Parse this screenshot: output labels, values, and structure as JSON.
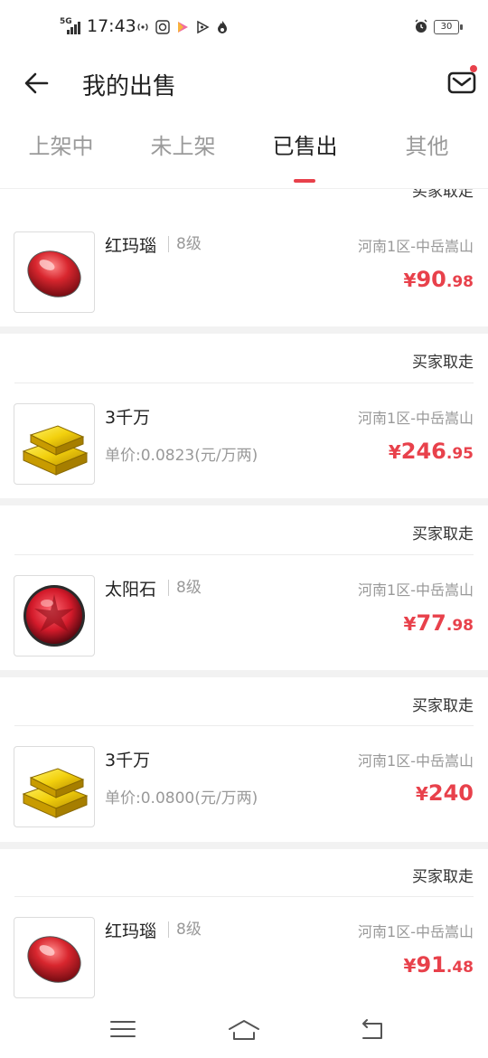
{
  "status_bar": {
    "network": "5G",
    "time": "17:43",
    "battery": "30",
    "icons": [
      "hotspot-icon",
      "qq-icon",
      "video-app-icon",
      "play-icon",
      "fire-icon",
      "alarm-icon"
    ]
  },
  "header": {
    "title": "我的出售",
    "back_icon": "arrow-left-icon",
    "mail_icon": "mail-icon",
    "has_notification_dot": true
  },
  "tabs": [
    {
      "label": "上架中",
      "active": false
    },
    {
      "label": "未上架",
      "active": false
    },
    {
      "label": "已售出",
      "active": true
    },
    {
      "label": "其他",
      "active": false
    }
  ],
  "colors": {
    "accent": "#e8414b",
    "muted_text": "#999999",
    "primary_text": "#222222",
    "divider": "#f2f2f2"
  },
  "list": {
    "peek_status": "买家取走",
    "items": [
      {
        "status": "",
        "image": "red-agate",
        "name": "红玛瑙",
        "level": "8级",
        "unit_price": "",
        "server": "河南1区-中岳嵩山",
        "price_currency": "¥",
        "price_int": "90",
        "price_dec": ".98"
      },
      {
        "status": "买家取走",
        "image": "gold-bars",
        "name": "3千万",
        "level": "",
        "unit_price": "单价:0.0823(元/万两)",
        "server": "河南1区-中岳嵩山",
        "price_currency": "¥",
        "price_int": "246",
        "price_dec": ".95"
      },
      {
        "status": "买家取走",
        "image": "sun-stone",
        "name": "太阳石",
        "level": "8级",
        "unit_price": "",
        "server": "河南1区-中岳嵩山",
        "price_currency": "¥",
        "price_int": "77",
        "price_dec": ".98"
      },
      {
        "status": "买家取走",
        "image": "gold-bars",
        "name": "3千万",
        "level": "",
        "unit_price": "单价:0.0800(元/万两)",
        "server": "河南1区-中岳嵩山",
        "price_currency": "¥",
        "price_int": "240",
        "price_dec": ""
      },
      {
        "status": "买家取走",
        "image": "red-agate",
        "name": "红玛瑙",
        "level": "8级",
        "unit_price": "",
        "server": "河南1区-中岳嵩山",
        "price_currency": "¥",
        "price_int": "91",
        "price_dec": ".48"
      }
    ]
  },
  "bottom_nav": {
    "icons": [
      "menu-icon",
      "home-icon",
      "back-nav-icon"
    ]
  }
}
